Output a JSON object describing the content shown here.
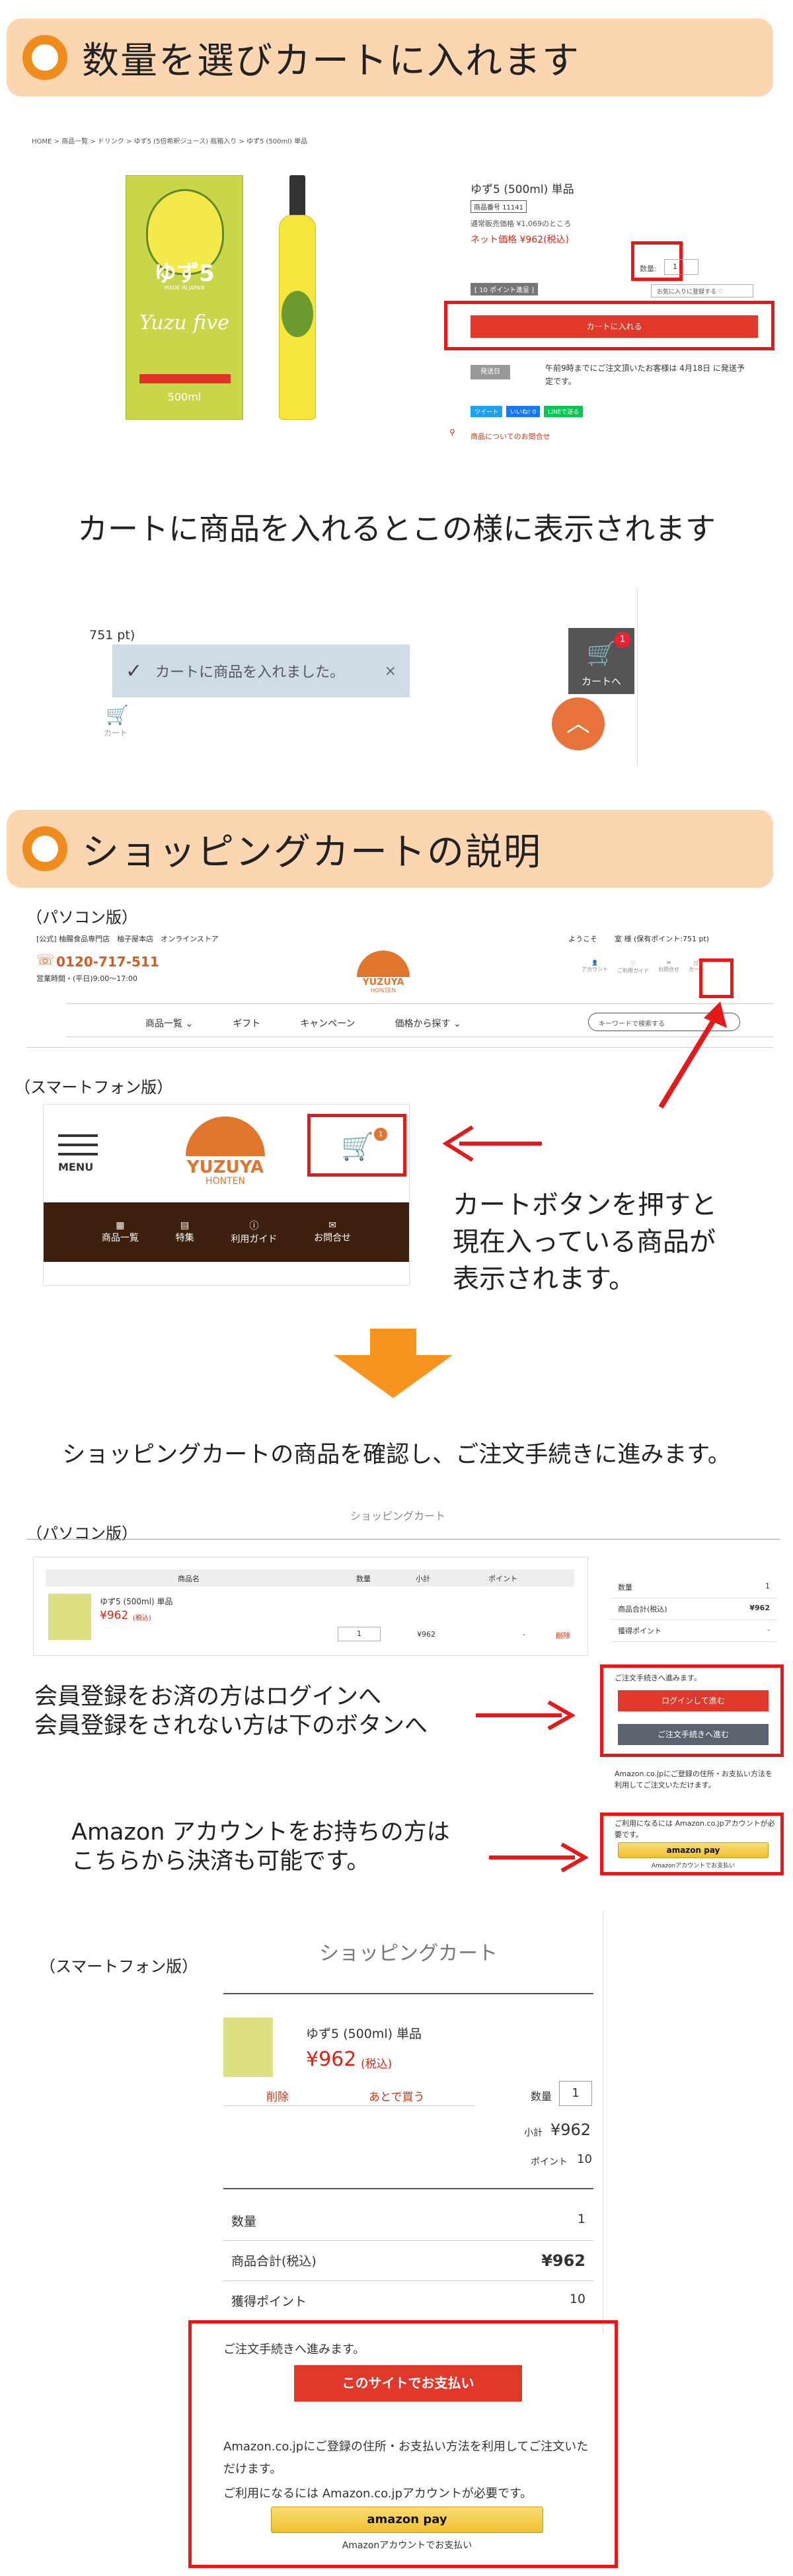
{
  "sec1": {
    "title": "数量を選びカートに入れます"
  },
  "breadcrumb": "HOME > 商品一覧 > ドリンク > ゆず5 (5倍希釈ジュース) 瓶箱入り > ゆず5 (500ml) 単品",
  "box_image": {
    "name": "ゆず5",
    "sub": "MADE IN JAPAN",
    "script": "Yuzu five",
    "volume": "500ml"
  },
  "product": {
    "name": "ゆず5 (500ml) 単品",
    "code": "商品番号 11141",
    "normal_price": "通常販売価格 ¥1,069のところ",
    "net_price": "ネット価格 ¥962(税込)",
    "points": "[ 10 ポイント進呈 ]",
    "qty_label": "数量:",
    "qty": "1",
    "fav": "お気に入りに登録する ♡",
    "cart_btn": "カートに入れる",
    "ship_badge": "発送日",
    "ship_text": "午前9時までにご注文頂いたお客様は 4月18日 に発送予定です。",
    "share": [
      "ツイート",
      "いいね! 0",
      "LINEで送る"
    ],
    "detail": "商品についてのお問合せ"
  },
  "caption1": "カートに商品を入れるとこの様に表示されます",
  "toast": {
    "pt": "751 pt)",
    "msg": "カートに商品を入れました。",
    "close": "×",
    "cart_label": "カート",
    "cart_count": "1",
    "cart_btn": "カートへ"
  },
  "sec2": {
    "title": "ショッピングカートの説明"
  },
  "pc_label": "（パソコン版）",
  "pc_header": {
    "store": "[公式] 柚腸食品専門店　柚子屋本店　オンラインストア",
    "phone": "0120-717-511",
    "hours": "営業時間・(平日)9:00〜17:00",
    "logo": "YUZUYA",
    "logo_sub": "HONTEN",
    "welcome": "ようこそ",
    "user": "室 様 (保有ポイント:751 pt)",
    "icons": [
      "アカウント",
      "ご利用ガイド",
      "お問合せ",
      "カート"
    ],
    "nav": [
      "商品一覧 ⌄",
      "ギフト",
      "キャンペーン",
      "価格から探す ⌄"
    ],
    "search": "キーワードで検索する"
  },
  "sp_label": "（スマートフォン版）",
  "sp_header": {
    "menu": "MENU",
    "logo": "YUZUYA",
    "logo_sub": "HONTEN",
    "cart_count": "1",
    "nav": [
      "商品一覧",
      "特集",
      "利用ガイド",
      "お問合せ"
    ]
  },
  "explain": "カートボタンを押すと\n現在入っている商品が\n表示されます。",
  "caption2": "ショッピングカートの商品を確認し、ご注文手続きに進みます。",
  "pc_cart": {
    "title": "ショッピングカート",
    "cols": [
      "商品名",
      "数量",
      "小計",
      "ポイント"
    ],
    "item": "ゆず5 (500ml) 単品",
    "price": "¥962",
    "tax": "(税込)",
    "qty": "1",
    "sub": "¥962",
    "pt": "-",
    "del": "削除",
    "summary": [
      [
        "数量",
        "1"
      ],
      [
        "商品合計(税込)",
        "¥962"
      ],
      [
        "獲得ポイント",
        "-"
      ]
    ],
    "proceed": "ご注文手続きへ進みます。",
    "login_btn": "ログインして進む",
    "guest_btn": "ご注文手続きへ進む",
    "amazon_note": "Amazon.co.jpにご登録の住所・お支払い方法を利用してご注文いただけます。",
    "amazon_need": "ご利用になるには Amazon.co.jpアカウントが必要です。",
    "amazon_btn": "amazon pay",
    "amazon_sub": "Amazonアカウントでお支払い"
  },
  "note_member": "会員登録をお済の方はログインへ\n会員登録をされない方は下のボタンへ",
  "note_amazon": "Amazon アカウントをお持ちの方は\nこちらから決済も可能です。",
  "sp_cart": {
    "title": "ショッピングカート",
    "item": "ゆず5 (500ml) 単品",
    "price": "¥962",
    "tax": "(税込)",
    "del": "削除",
    "later": "あとで買う",
    "qty_label": "数量",
    "qty": "1",
    "sub_label": "小計",
    "sub": "¥962",
    "pt_label": "ポイント",
    "pt": "10",
    "summary": [
      [
        "数量",
        "1"
      ],
      [
        "商品合計(税込)",
        "¥962"
      ],
      [
        "獲得ポイント",
        "10"
      ]
    ],
    "proceed": "ご注文手続きへ進みます。",
    "pay_btn": "このサイトでお支払い",
    "amazon_note": "Amazon.co.jpにご登録の住所・お支払い方法を利用してご注文いただけます。",
    "amazon_need": "ご利用になるには Amazon.co.jpアカウントが必要です。",
    "amazon_btn": "amazon pay",
    "amazon_sub": "Amazonアカウントでお支払い"
  },
  "colors": {
    "accent": "#f08c1c",
    "red": "#e21a1a",
    "brown": "#3d200d",
    "logo": "#e0752b"
  }
}
